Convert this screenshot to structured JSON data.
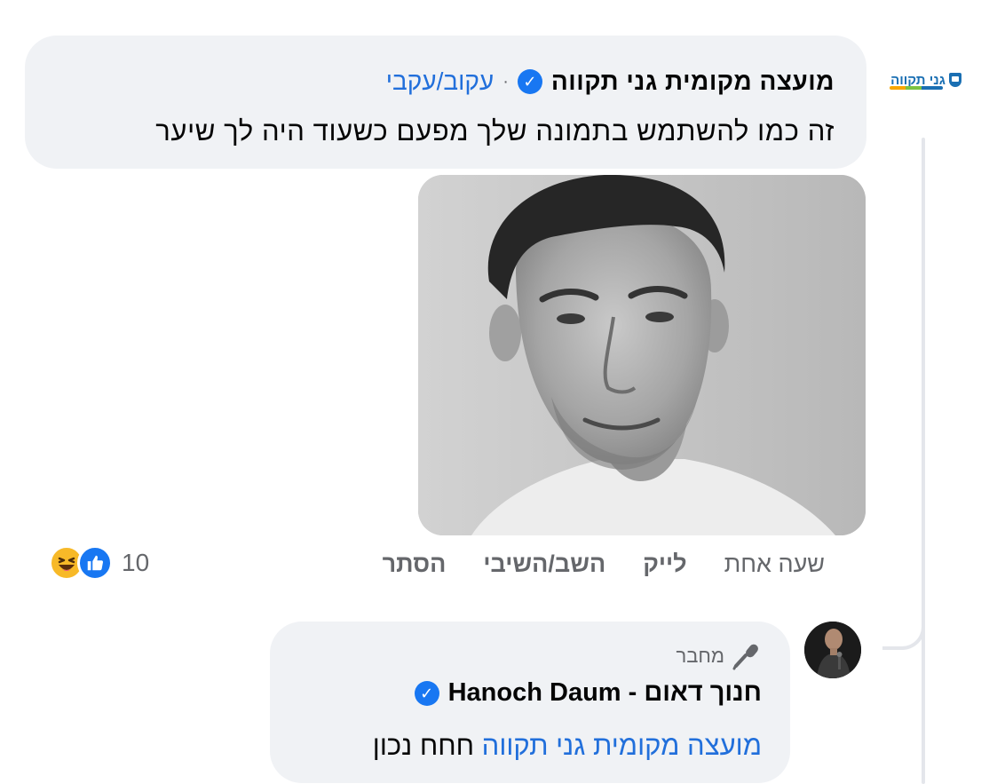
{
  "comment": {
    "author": "מועצה מקומית גני תקווה",
    "separator": "·",
    "follow_label": "עקוב/עקבי",
    "text": "זה כמו להשתמש בתמונה שלך מפעם כשעוד היה לך שיער",
    "page_logo_text": "גני תקווה",
    "actions": {
      "time": "שעה אחת",
      "like": "לייק",
      "reply": "השב/השיבי",
      "hide": "הסתר"
    },
    "reactions": {
      "count": "10",
      "types": [
        "haha",
        "like"
      ]
    }
  },
  "reply": {
    "badge_label": "מחבר",
    "badge_icon": "microphone-icon",
    "author": "חנוך דאום - Hanoch Daum",
    "mention": "מועצה מקומית גני תקווה",
    "text": "חחח נכון"
  },
  "colors": {
    "bubble": "#f0f2f5",
    "link": "#216fdb",
    "verified": "#1877f2",
    "muted": "#65676b",
    "thread_line": "#e4e6eb"
  }
}
